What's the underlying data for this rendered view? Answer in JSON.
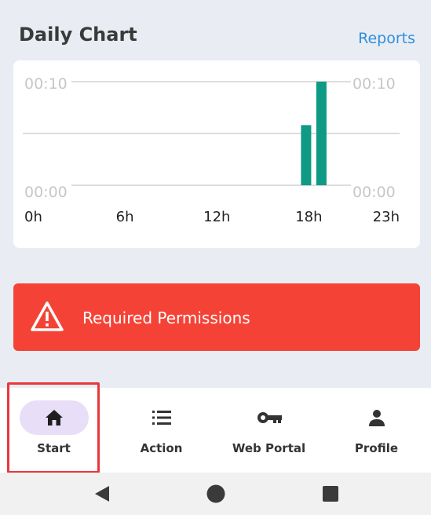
{
  "header": {
    "title": "Daily Chart",
    "reports_link": "Reports"
  },
  "chart_data": {
    "type": "bar",
    "x_tick_labels": [
      "0h",
      "6h",
      "12h",
      "18h",
      "23h"
    ],
    "y_left_labels": [
      "00:10",
      "00:00"
    ],
    "y_right_labels": [
      "00:10",
      "00:00"
    ],
    "xlim": [
      0,
      23
    ],
    "ylim_minutes": [
      0,
      10
    ],
    "bars": [
      {
        "hour": 17,
        "minutes": 5.8
      },
      {
        "hour": 18,
        "minutes": 10.0
      }
    ],
    "bar_color": "#0f9a85",
    "grid": true
  },
  "permissions_banner": {
    "label": "Required Permissions",
    "icon": "warning-icon",
    "color": "#f44336"
  },
  "bottom_nav": {
    "items": [
      {
        "label": "Start",
        "icon": "home-icon",
        "active": true
      },
      {
        "label": "Action",
        "icon": "list-icon",
        "active": false
      },
      {
        "label": "Web Portal",
        "icon": "key-icon",
        "active": false
      },
      {
        "label": "Profile",
        "icon": "person-icon",
        "active": false
      }
    ]
  },
  "system_nav": {
    "buttons": [
      "back-icon",
      "home-circle-icon",
      "recents-icon"
    ]
  }
}
